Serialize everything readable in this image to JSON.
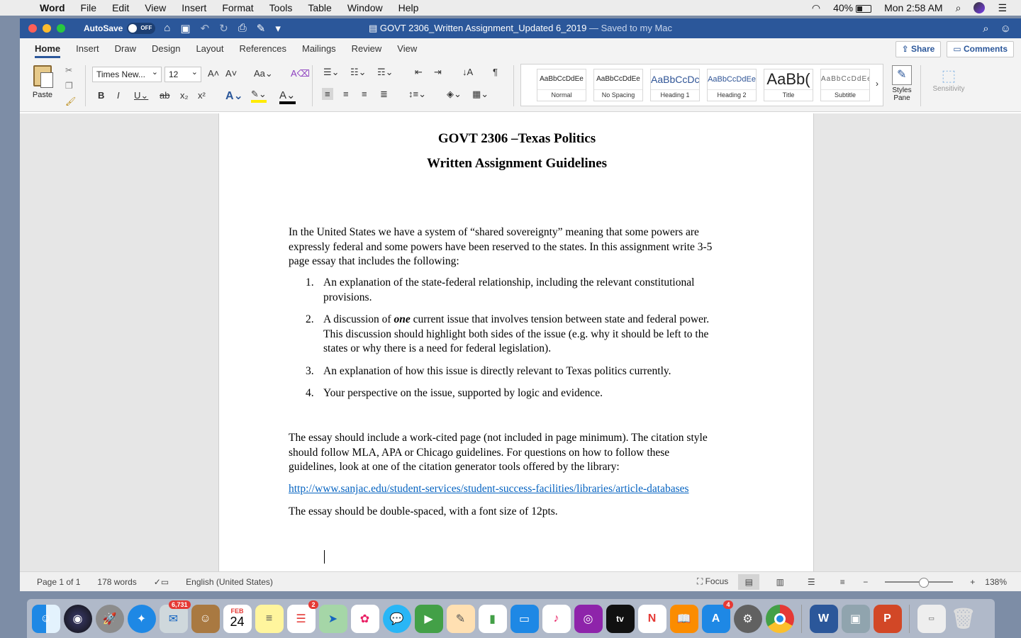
{
  "menubar": {
    "app": "Word",
    "items": [
      "File",
      "Edit",
      "View",
      "Insert",
      "Format",
      "Tools",
      "Table",
      "Window",
      "Help"
    ],
    "battery": "40%",
    "clock": "Mon 2:58 AM"
  },
  "titlebar": {
    "autosave": "AutoSave",
    "toggle": "OFF",
    "doc_name": "GOVT 2306_Written Assignment_Updated 6_2019",
    "saved_status": "— Saved to my Mac"
  },
  "tabs": [
    "Home",
    "Insert",
    "Draw",
    "Design",
    "Layout",
    "References",
    "Mailings",
    "Review",
    "View"
  ],
  "tab_buttons": {
    "share": "Share",
    "comments": "Comments"
  },
  "ribbon": {
    "paste": "Paste",
    "font_name": "Times New...",
    "font_size": "12",
    "styles": [
      {
        "preview": "AaBbCcDdEe",
        "name": "Normal"
      },
      {
        "preview": "AaBbCcDdEe",
        "name": "No Spacing"
      },
      {
        "preview": "AaBbCcDc",
        "name": "Heading 1"
      },
      {
        "preview": "AaBbCcDdEe",
        "name": "Heading 2"
      },
      {
        "preview": "AaBb(",
        "name": "Title"
      },
      {
        "preview": "AaBbCcDdEe",
        "name": "Subtitle"
      }
    ],
    "styles_pane": "Styles Pane",
    "sensitivity": "Sensitivity"
  },
  "document": {
    "title": "GOVT 2306 –Texas Politics",
    "subtitle": "Written Assignment Guidelines",
    "intro_lines": [
      "In the United States we have a system of “shared sovereignty” meaning that some powers are",
      "expressly federal and some powers have been reserved to the states. In this assignment write 3-5",
      "page essay that includes the following:"
    ],
    "list": [
      {
        "num": "1.",
        "lines": [
          "An explanation of the state-federal relationship, including the relevant constitutional",
          "provisions."
        ]
      },
      {
        "num": "2.",
        "lines": [
          "A discussion of one current issue that involves tension between state and federal power.",
          "This discussion should highlight both sides of the issue (e.g. why it should be left to the",
          "states or why there is a need for federal legislation)."
        ]
      },
      {
        "num": "3.",
        "lines": [
          "An explanation of how this issue is directly relevant to Texas politics currently."
        ]
      },
      {
        "num": "4.",
        "lines": [
          "Your perspective on the issue, supported by logic and evidence."
        ]
      }
    ],
    "essay_lines": [
      "The essay should include a work-cited page (not included in page minimum). The citation style",
      "should follow MLA, APA or Chicago guidelines. For questions on how to follow these",
      "guidelines, look at one of the citation generator tools offered by the library:"
    ],
    "link": "http://www.sanjac.edu/student-services/student-success-facilities/libraries/article-databases",
    "closing": "The essay should be double-spaced, with a font size of 12pts."
  },
  "status": {
    "page": "Page 1 of 1",
    "words": "178 words",
    "language": "English (United States)",
    "focus": "Focus",
    "zoom": "138%"
  },
  "dock": {
    "mail_badge": "6,731",
    "calendar_month": "FEB",
    "calendar_day": "24",
    "reminders_badge": "2",
    "appstore_badge": "4"
  }
}
